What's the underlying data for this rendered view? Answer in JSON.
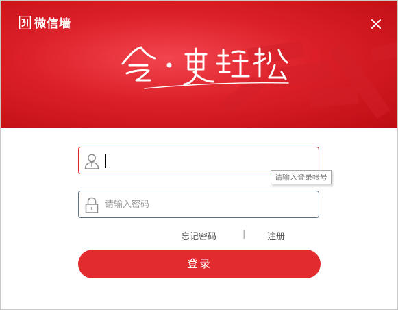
{
  "app": {
    "brand_name": "微信墙",
    "brand_mark_icon": "wechat-wall-logo"
  },
  "banner": {
    "slogan": "会 · 更轻松",
    "background_color": "#dc1f28"
  },
  "login_form": {
    "username": {
      "value": "",
      "tooltip": "请输入登录帐号",
      "icon": "user-icon"
    },
    "password": {
      "value": "",
      "placeholder": "请输入密码",
      "icon": "lock-icon"
    },
    "forgot_password_label": "忘记密码",
    "separator": "|",
    "register_label": "注册",
    "login_button_label": "登录"
  },
  "colors": {
    "accent": "#e12b2f",
    "focus_border": "#d9232f",
    "field_border": "#5f7282"
  }
}
